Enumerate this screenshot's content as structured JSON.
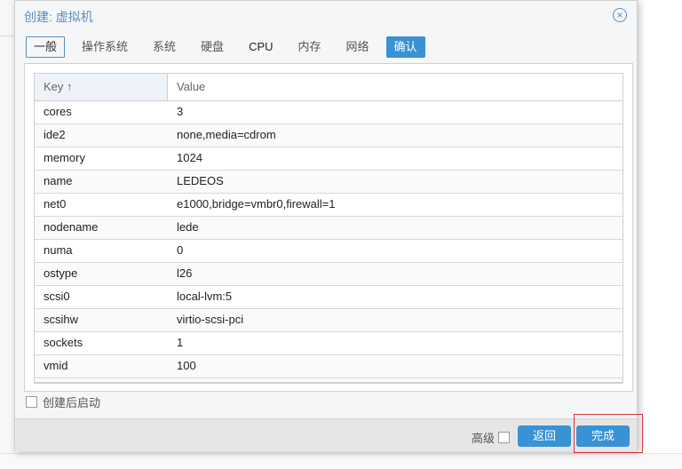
{
  "dialog": {
    "title": "创建: 虚拟机",
    "close_icon": "close-circle-icon"
  },
  "tabs": [
    {
      "label": "一般"
    },
    {
      "label": "操作系统"
    },
    {
      "label": "系统"
    },
    {
      "label": "硬盘"
    },
    {
      "label": "CPU"
    },
    {
      "label": "内存"
    },
    {
      "label": "网络"
    },
    {
      "label": "确认",
      "active": true
    }
  ],
  "grid": {
    "columns": {
      "key": "Key ↑",
      "value": "Value"
    },
    "rows": [
      {
        "key": "cores",
        "value": "3"
      },
      {
        "key": "ide2",
        "value": "none,media=cdrom"
      },
      {
        "key": "memory",
        "value": "1024"
      },
      {
        "key": "name",
        "value": "LEDEOS"
      },
      {
        "key": "net0",
        "value": "e1000,bridge=vmbr0,firewall=1"
      },
      {
        "key": "nodename",
        "value": "lede"
      },
      {
        "key": "numa",
        "value": "0"
      },
      {
        "key": "ostype",
        "value": "l26"
      },
      {
        "key": "scsi0",
        "value": "local-lvm:5"
      },
      {
        "key": "scsihw",
        "value": "virtio-scsi-pci"
      },
      {
        "key": "sockets",
        "value": "1"
      },
      {
        "key": "vmid",
        "value": "100"
      }
    ]
  },
  "start_after_create": {
    "label": "创建后启动",
    "checked": false
  },
  "footer": {
    "advanced_label": "高级",
    "advanced_checked": false,
    "back_label": "返回",
    "finish_label": "完成"
  }
}
